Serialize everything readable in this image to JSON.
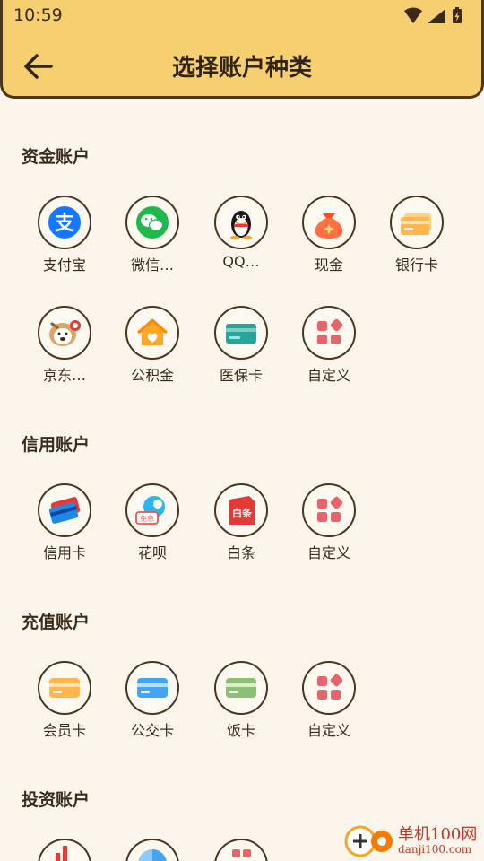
{
  "status": {
    "time": "10:59"
  },
  "header": {
    "title": "选择账户种类"
  },
  "sections": [
    {
      "title": "资金账户",
      "items": [
        {
          "label": "支付宝",
          "icon": "alipay-icon"
        },
        {
          "label": "微信…",
          "icon": "wechat-icon"
        },
        {
          "label": "QQ…",
          "icon": "qq-icon"
        },
        {
          "label": "现金",
          "icon": "cash-bag-icon"
        },
        {
          "label": "银行卡",
          "icon": "bank-card-icon"
        },
        {
          "label": "京东…",
          "icon": "jd-icon"
        },
        {
          "label": "公积金",
          "icon": "house-fund-icon"
        },
        {
          "label": "医保卡",
          "icon": "medical-card-icon"
        },
        {
          "label": "自定义",
          "icon": "custom-grid-icon"
        }
      ]
    },
    {
      "title": "信用账户",
      "items": [
        {
          "label": "信用卡",
          "icon": "credit-card-icon"
        },
        {
          "label": "花呗",
          "icon": "huabei-icon"
        },
        {
          "label": "白条",
          "icon": "baitiao-icon"
        },
        {
          "label": "自定义",
          "icon": "custom-grid-icon"
        }
      ]
    },
    {
      "title": "充值账户",
      "items": [
        {
          "label": "会员卡",
          "icon": "member-card-icon"
        },
        {
          "label": "公交卡",
          "icon": "bus-card-icon"
        },
        {
          "label": "饭卡",
          "icon": "meal-card-icon"
        },
        {
          "label": "自定义",
          "icon": "custom-grid-icon"
        }
      ]
    },
    {
      "title": "投资账户",
      "items": [
        {
          "label": "",
          "icon": "stock-chart-icon"
        },
        {
          "label": "",
          "icon": "fund-pie-icon"
        },
        {
          "label": "",
          "icon": "investment-icon"
        }
      ]
    }
  ],
  "watermark": {
    "line1": "单机100网",
    "line2": "danji100.com"
  },
  "colors": {
    "header": "#f6d070",
    "background": "#fbf5ec",
    "border": "#4a3620",
    "custom_icon": "#e9636a"
  }
}
